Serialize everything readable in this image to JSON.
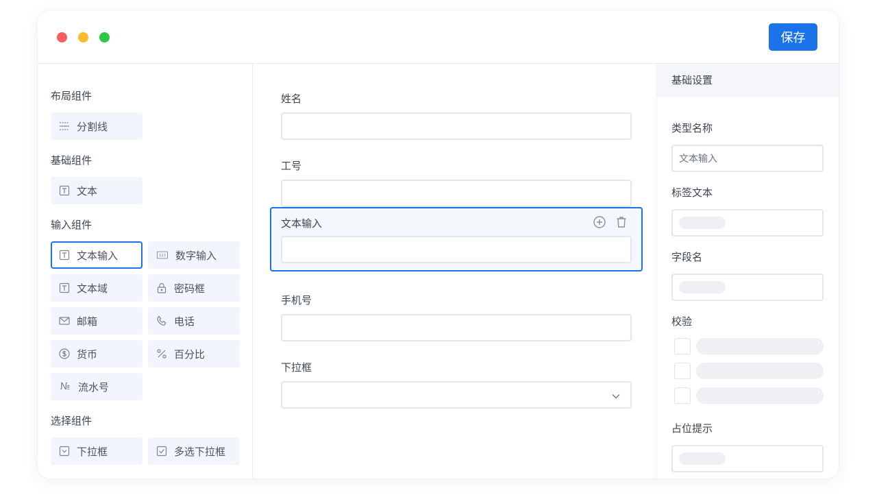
{
  "toolbar": {
    "save_label": "保存"
  },
  "palette": {
    "layout_group": "布局组件",
    "basic_group": "基础组件",
    "input_group": "输入组件",
    "select_group": "选择组件",
    "items": {
      "divider": "分割线",
      "text": "文本",
      "text_input": "文本输入",
      "number_input": "数字输入",
      "textarea": "文本域",
      "password": "密码框",
      "email": "邮箱",
      "phone": "电话",
      "currency": "货币",
      "percent": "百分比",
      "serial": "流水号",
      "dropdown": "下拉框",
      "multi_dropdown": "多选下拉框"
    },
    "serial_icon_text": "№",
    "number_icon_text": "123"
  },
  "canvas": {
    "fields": [
      {
        "label": "姓名"
      },
      {
        "label": "工号"
      },
      {
        "label": "文本输入"
      },
      {
        "label": "手机号"
      },
      {
        "label": "下拉框"
      }
    ]
  },
  "settings": {
    "header": "基础设置",
    "type_name_label": "类型名称",
    "type_name_value": "文本输入",
    "label_text_label": "标签文本",
    "field_name_label": "字段名",
    "validation_label": "校验",
    "placeholder_label": "占位提示"
  },
  "colors": {
    "accent": "#1a73e8",
    "panel_bg": "#f2f6fc"
  }
}
